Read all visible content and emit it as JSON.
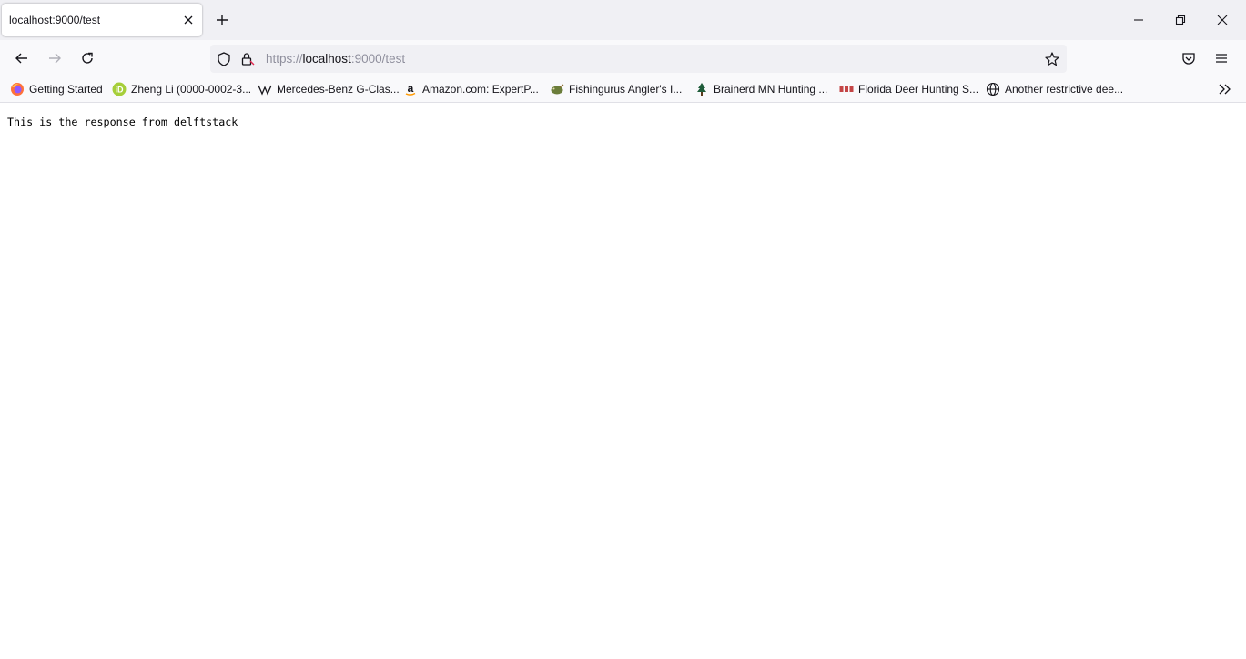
{
  "tab": {
    "title": "localhost:9000/test"
  },
  "address": {
    "scheme": "https://",
    "host": "localhost",
    "rest": ":9000/test"
  },
  "bookmarks": [
    {
      "label": "Getting Started",
      "icon": "firefox-icon"
    },
    {
      "label": "Zheng Li (0000-0002-3...",
      "icon": "orcid-icon"
    },
    {
      "label": "Mercedes-Benz G-Clas...",
      "icon": "wikipedia-icon"
    },
    {
      "label": "Amazon.com: ExpertP...",
      "icon": "amazon-icon"
    },
    {
      "label": "Fishingurus Angler's I...",
      "icon": "fishingurus-icon"
    },
    {
      "label": "Brainerd MN Hunting ...",
      "icon": "pine-tree-icon"
    },
    {
      "label": "Florida Deer Hunting S...",
      "icon": "site-icon"
    },
    {
      "label": "Another restrictive dee...",
      "icon": "globe-icon"
    }
  ],
  "page": {
    "text": "This is the response from delftstack"
  },
  "colors": {
    "chrome": "#f0f0f4",
    "toolbar": "#f9f9fb",
    "text": "#15141a",
    "muted": "#8f8f9d",
    "orcid": "#a6ce39"
  }
}
